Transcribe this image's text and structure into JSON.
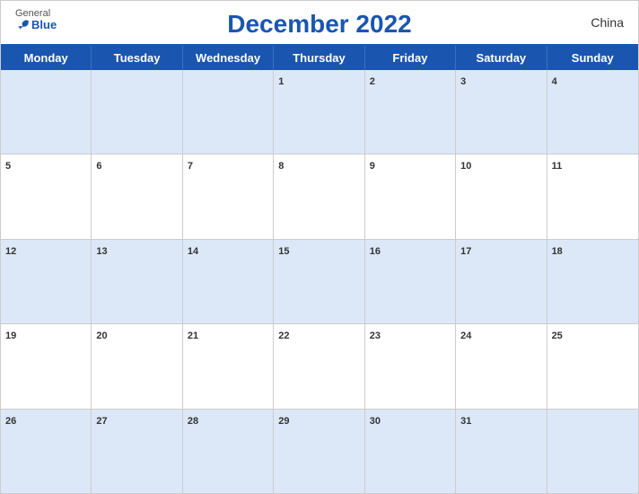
{
  "header": {
    "logo_general": "General",
    "logo_blue": "Blue",
    "title": "December 2022",
    "country": "China"
  },
  "day_headers": [
    "Monday",
    "Tuesday",
    "Wednesday",
    "Thursday",
    "Friday",
    "Saturday",
    "Sunday"
  ],
  "weeks": [
    [
      {
        "day": "",
        "empty": true
      },
      {
        "day": "",
        "empty": true
      },
      {
        "day": "",
        "empty": true
      },
      {
        "day": "1",
        "empty": false
      },
      {
        "day": "2",
        "empty": false
      },
      {
        "day": "3",
        "empty": false
      },
      {
        "day": "4",
        "empty": false
      }
    ],
    [
      {
        "day": "5",
        "empty": false
      },
      {
        "day": "6",
        "empty": false
      },
      {
        "day": "7",
        "empty": false
      },
      {
        "day": "8",
        "empty": false
      },
      {
        "day": "9",
        "empty": false
      },
      {
        "day": "10",
        "empty": false
      },
      {
        "day": "11",
        "empty": false
      }
    ],
    [
      {
        "day": "12",
        "empty": false
      },
      {
        "day": "13",
        "empty": false
      },
      {
        "day": "14",
        "empty": false
      },
      {
        "day": "15",
        "empty": false
      },
      {
        "day": "16",
        "empty": false
      },
      {
        "day": "17",
        "empty": false
      },
      {
        "day": "18",
        "empty": false
      }
    ],
    [
      {
        "day": "19",
        "empty": false
      },
      {
        "day": "20",
        "empty": false
      },
      {
        "day": "21",
        "empty": false
      },
      {
        "day": "22",
        "empty": false
      },
      {
        "day": "23",
        "empty": false
      },
      {
        "day": "24",
        "empty": false
      },
      {
        "day": "25",
        "empty": false
      }
    ],
    [
      {
        "day": "26",
        "empty": false
      },
      {
        "day": "27",
        "empty": false
      },
      {
        "day": "28",
        "empty": false
      },
      {
        "day": "29",
        "empty": false
      },
      {
        "day": "30",
        "empty": false
      },
      {
        "day": "31",
        "empty": false
      },
      {
        "day": "",
        "empty": true
      }
    ]
  ]
}
